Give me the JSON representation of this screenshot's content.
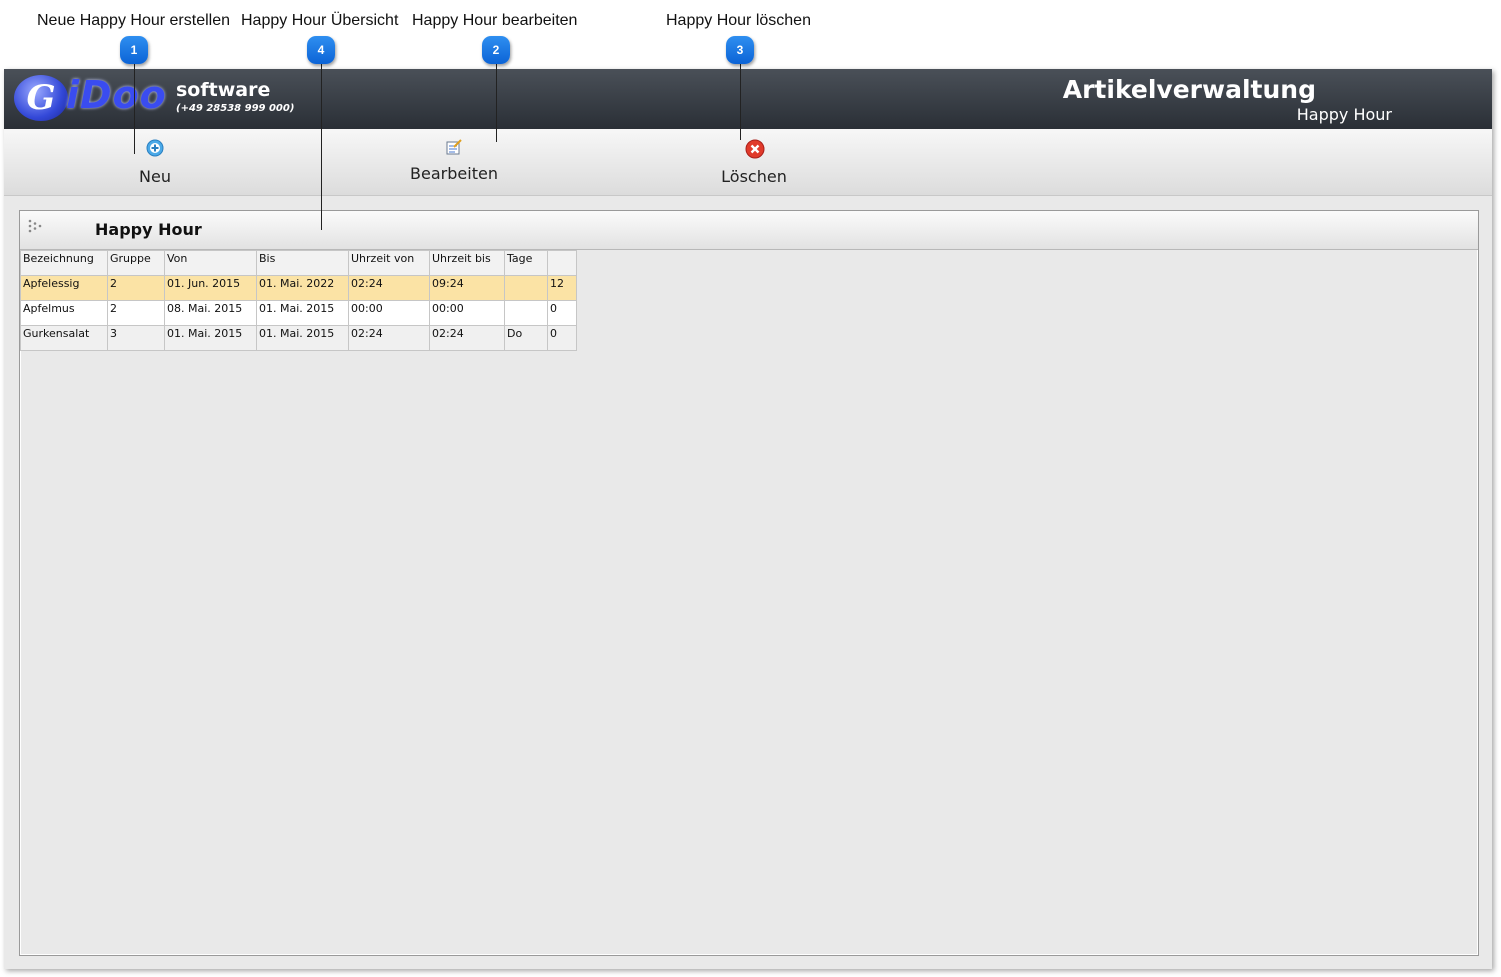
{
  "annotations": [
    {
      "number": "1",
      "label": "Neue Happy Hour erstellen"
    },
    {
      "number": "4",
      "label": "Happy Hour Übersicht"
    },
    {
      "number": "2",
      "label": "Happy Hour bearbeiten"
    },
    {
      "number": "3",
      "label": "Happy Hour löschen"
    }
  ],
  "header": {
    "logo_text": "iDoo",
    "brand": "software",
    "phone": "(+49 28538 999 000)",
    "title": "Artikelverwaltung",
    "subtitle": "Happy Hour"
  },
  "toolbar": {
    "new_label": "Neu",
    "edit_label": "Bearbeiten",
    "delete_label": "Löschen"
  },
  "panel": {
    "title": "Happy Hour"
  },
  "table": {
    "columns": [
      "Bezeichnung",
      "Gruppe",
      "Von",
      "Bis",
      "Uhrzeit von",
      "Uhrzeit bis",
      "Tage",
      ""
    ],
    "rows": [
      [
        "Apfelessig",
        "2",
        "01. Jun. 2015",
        "01. Mai. 2022",
        "02:24",
        "09:24",
        "",
        "12"
      ],
      [
        "Apfelmus",
        "2",
        "08. Mai. 2015",
        "01. Mai. 2015",
        "00:00",
        "00:00",
        "",
        "0"
      ],
      [
        "Gurkensalat",
        "3",
        "01. Mai. 2015",
        "01. Mai. 2015",
        "02:24",
        "02:24",
        "Do",
        "0"
      ]
    ],
    "selected_row": 0
  },
  "colors": {
    "header_bg": "#2a2f36",
    "selected_row": "#fbe3a5",
    "badge": "#0b63d6"
  },
  "icons": {
    "new": "add-circle-icon",
    "edit": "edit-note-icon",
    "delete": "delete-red-x-icon"
  }
}
